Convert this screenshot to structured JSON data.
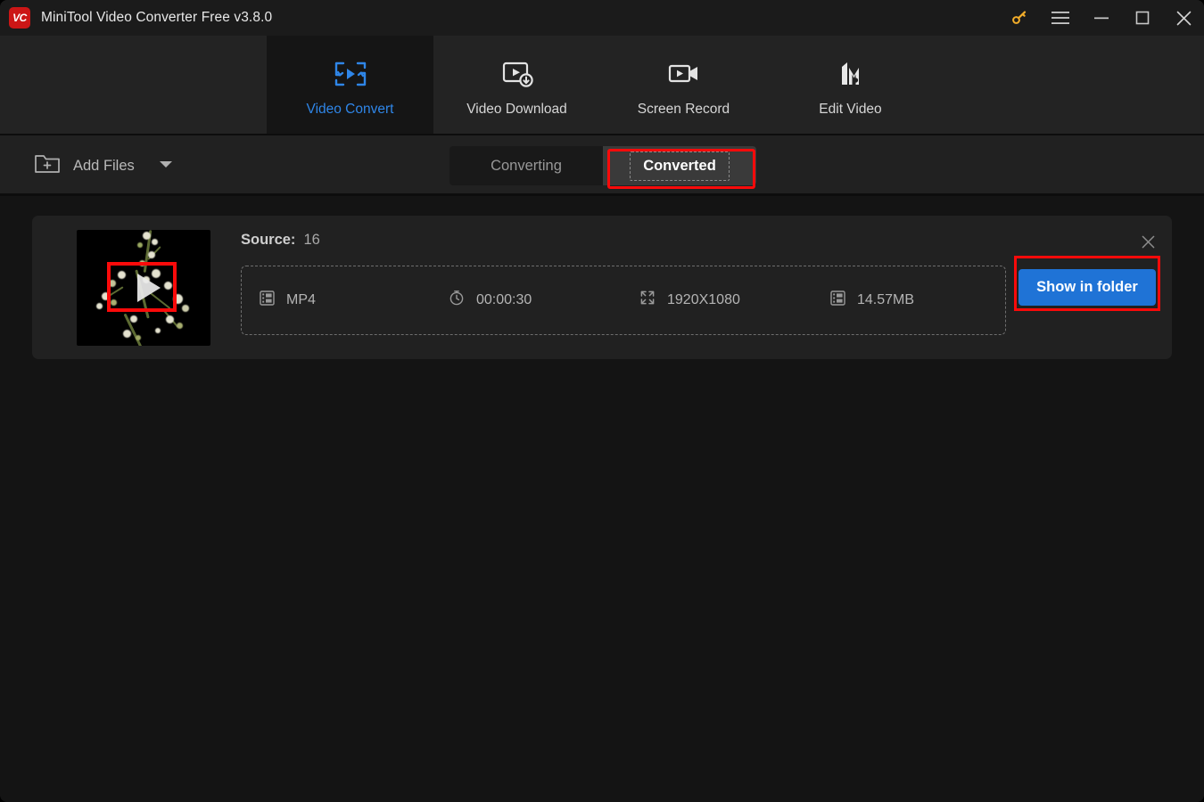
{
  "window": {
    "title": "MiniTool Video Converter Free v3.8.0",
    "logo_text": "VC",
    "brand_red": "#cc1616",
    "accent_blue": "#2f86e8",
    "highlight_red": "#fb0a0a"
  },
  "title_bar": {
    "buttons": [
      {
        "name": "key-icon",
        "label": "Activate"
      },
      {
        "name": "hamburger-menu-icon",
        "label": "Menu"
      },
      {
        "name": "minimize-icon",
        "label": "Minimize"
      },
      {
        "name": "maximize-icon",
        "label": "Maximize"
      },
      {
        "name": "close-icon",
        "label": "Close"
      }
    ]
  },
  "nav": {
    "tabs": [
      {
        "label": "Video Convert",
        "icon": "video-convert-icon",
        "active": true
      },
      {
        "label": "Video Download",
        "icon": "video-download-icon",
        "active": false
      },
      {
        "label": "Screen Record",
        "icon": "screen-record-icon",
        "active": false
      },
      {
        "label": "Edit Video",
        "icon": "edit-video-icon",
        "active": false
      }
    ]
  },
  "toolbar": {
    "add_files_label": "Add Files",
    "add_files_icon": "folder-plus-icon",
    "dropdown_icon": "caret-down-icon",
    "segmented_tabs": [
      {
        "label": "Converting",
        "active": false
      },
      {
        "label": "Converted",
        "active": true
      }
    ]
  },
  "file_card": {
    "source_label": "Source:",
    "source_value": "16",
    "thumbnail_alt": "video-thumbnail-flowers",
    "play_icon": "play-icon",
    "close_icon": "close-icon",
    "meta": [
      {
        "icon": "format-icon",
        "value": "MP4"
      },
      {
        "icon": "clock-icon",
        "value": "00:00:30"
      },
      {
        "icon": "resolution-icon",
        "value": "1920X1080"
      },
      {
        "icon": "filesize-icon",
        "value": "14.57MB"
      }
    ],
    "action_label": "Show in folder"
  }
}
